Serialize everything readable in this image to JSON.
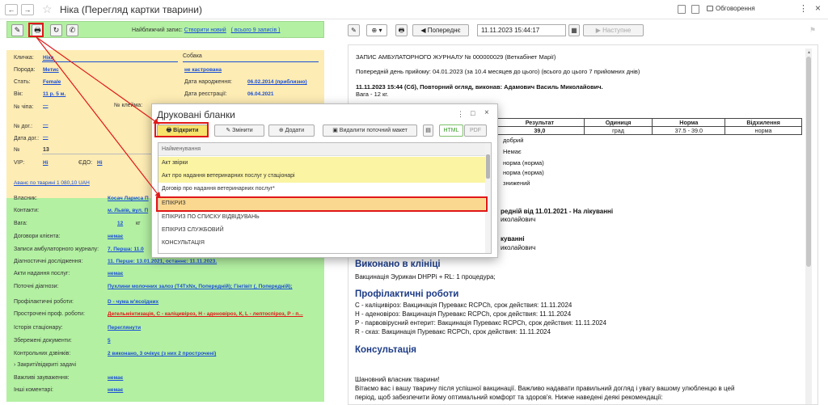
{
  "window": {
    "title": "Ніка (Перегляд картки тварини)",
    "discuss_label": "Обговорення",
    "back": "←",
    "forward": "→",
    "star": "☆",
    "kebab": "⋮",
    "close": "×"
  },
  "left_toolbar": {
    "nearest_label": "Найближчий запис:",
    "create_new": "Створити новий",
    "all_records": "( всього 9 записів )"
  },
  "animal": {
    "name_label": "Кличка:",
    "name_value": "Ніка",
    "species_value": "Собака",
    "breed_label": "Порода:",
    "breed_value": "Метис",
    "castration_value": "не кастрована",
    "sex_label": "Стать:",
    "sex_value": "Female",
    "birth_label": "Дата народження:",
    "birth_value": "06.02.2014 (приблизно)",
    "age_label": "Вік:",
    "age_value": "11 р. 5 м.",
    "reg_label": "Дата реєстрації:",
    "reg_value": "06.04.2021",
    "chip_label": "№ чіпа:",
    "chip_value": "—",
    "brand_label": "№ клейма:",
    "contract_label": "№ дог.:",
    "contract_value": "—",
    "contract_date_label": "Дата дог.:",
    "contract_date_value": "—",
    "num_label": "№",
    "num_value": "13",
    "vip_label": "VIP:",
    "vip_value": "Ні",
    "edo_label": "ЄДО:",
    "edo_value": "Ні",
    "advance": "Аванс по тварині 1 080,10 UAH"
  },
  "owner": {
    "owner_label": "Власник:",
    "owner_value": "Косач Лариса П",
    "contacts_label": "Контакти:",
    "contacts_value": "м. Львів, вул. П",
    "weight_label": "Вага:",
    "weight_value": "12",
    "weight_unit": "кг",
    "client_contracts_label": "Договори клієнта:",
    "client_contracts_value": "немає",
    "journal_label": "Записи амбулаторного журналу:",
    "journal_value": "7. Перша: 11.0",
    "diag_label": "Діагностичні дослідження:",
    "diag_value": "11. Перше: 13.01.2021, останнє: 11.11.2023.",
    "service_acts_label": "Акти надання послуг:",
    "service_acts_value": "немає",
    "current_diag_label": "Поточні діагнози:",
    "current_diag_value": "Пухлини молочних залоз (T4TxNx, Попередній); Гінгівіт (, Попередній);",
    "prof_label": "Профілактичні роботи:",
    "prof_value": "D - чума м'ясоїдних",
    "overdue_label": "Прострочені проф. роботи:",
    "overdue_value": "Дегельмінтизація, С - каліцивіроз, Н - аденовіроз, К, L - лептоспіроз, Р - п...",
    "hospital_label": "Історія стаціонару:",
    "hospital_value": "Переглянути",
    "saved_docs_label": "Збережені документи:",
    "saved_docs_value": "5",
    "control_label": "Контрольних дзвінків:",
    "control_value": "2 виконано, 3 очікує (з них 2 прострочені)",
    "tasks_label": "Закриті/відкриті задачі",
    "notes_label": "Важливі зауваження:",
    "notes_value": "немає",
    "comments_label": "Інші коментарі:",
    "comments_value": "немає"
  },
  "right_toolbar": {
    "prev": "Попереднє",
    "datetime": "11.11.2023 15:44:17",
    "next": "Наступне"
  },
  "doc": {
    "header": "ЗАПИС АМБУЛАТОРНОГО ЖУРНАЛУ № 000000029 (Веткабінет Марії)",
    "prev_day": "Попередній день прийому: 04.01.2023 (за 10.4 месяцев до цього) (всього до цього 7 прийомних днів)",
    "visit": "11.11.2023 15:44 (Сб), Повторний огляд, виконав: Адамович Василь Миколайович.",
    "weight": "Вага - 12 кг.",
    "table_headers": [
      "Результат",
      "Одиниця",
      "Норма",
      "Відхилення"
    ],
    "table_row": [
      "39,0",
      "град",
      "37.5 - 39.0",
      "норма"
    ],
    "obs": [
      "добрий",
      "Немає",
      "норма (норма)",
      "норма (норма)",
      "знижений"
    ],
    "prev_diag": "редній від 11.01.2021 - На лікуванні",
    "doctor1": "иколайович",
    "treat": "куванні",
    "doctor2": "иколайович",
    "done_title": "Виконано в клініці",
    "done_text": "Вакцинація Эурикан DHPPi + RL: 1 процедура;",
    "prof_title": "Профілактичні роботи",
    "prof_items": [
      "С - каліцивіроз: Вакцинація Пуревакс RCPCh, срок действия: 11.11.2024",
      "Н - аденовіроз: Вакцинація Пуревакс RCPCh, срок действия: 11.11.2024",
      "Р - парвовірусний ентерит: Вакцинація Пуревакс RCPCh, срок действия: 11.11.2024",
      "R - сказ: Вакцинація Пуревакс RCPCh, срок действия: 11.11.2024"
    ],
    "consult_title": "Консультація",
    "greeting": "Шановний власник тварини!",
    "advice1": "Вітаємо вас і вашу тварину після успішної вакцинації. Важливо надавати правильний догляд і увагу вашому улюбленцю в цей",
    "advice2": "період, щоб забезпечити йому оптимальний комфорт та здоров'я. Нижче наведені деякі рекомендації:"
  },
  "dialog": {
    "title": "Друковані бланки",
    "open": "Відкрити",
    "edit": "Змінити",
    "add": "Додати",
    "delete": "Видалити поточний макет",
    "html": "HTML",
    "pdf": "PDF",
    "column": "Найменування",
    "items": [
      "Акт звірки",
      "Акт про надання ветеринарних послуг у стаціонарі",
      "Договір про надання ветеринарних послуг*",
      "ЕПІКРИЗ",
      "ЕПІКРИЗ ПО СПИСКУ ВІДВІДУВАНЬ",
      "ЕПІКРИЗ СЛУЖБОВИЙ",
      "КОНСУЛЬТАЦІЯ"
    ]
  },
  "colors": {
    "green": "#b3f0a2",
    "yellow": "#fdecb4",
    "highlight": "#fbf4a2",
    "red": "#e01818",
    "link": "#1a4fd6"
  }
}
